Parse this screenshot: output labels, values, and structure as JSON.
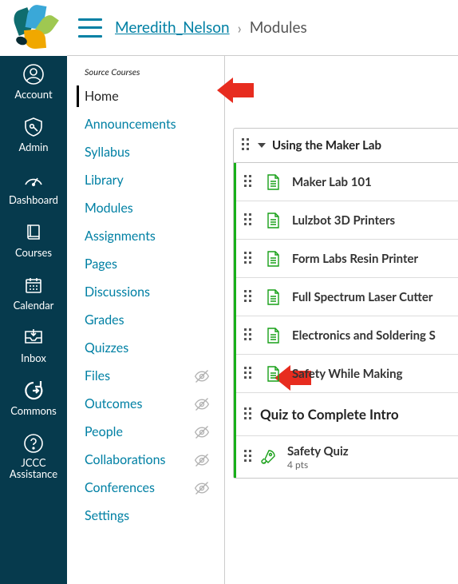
{
  "breadcrumbs": {
    "course": "Meredith_Nelson",
    "current": "Modules"
  },
  "global_nav": [
    {
      "key": "account",
      "label": "Account"
    },
    {
      "key": "admin",
      "label": "Admin"
    },
    {
      "key": "dashboard",
      "label": "Dashboard"
    },
    {
      "key": "courses",
      "label": "Courses"
    },
    {
      "key": "calendar",
      "label": "Calendar"
    },
    {
      "key": "inbox",
      "label": "Inbox"
    },
    {
      "key": "commons",
      "label": "Commons"
    },
    {
      "key": "help",
      "label": "JCCC Assistance"
    }
  ],
  "course_nav": {
    "header": "Source Courses",
    "items": [
      {
        "label": "Home",
        "active": true,
        "hidden": false
      },
      {
        "label": "Announcements",
        "active": false,
        "hidden": false
      },
      {
        "label": "Syllabus",
        "active": false,
        "hidden": false
      },
      {
        "label": "Library",
        "active": false,
        "hidden": false
      },
      {
        "label": "Modules",
        "active": false,
        "hidden": false
      },
      {
        "label": "Assignments",
        "active": false,
        "hidden": false
      },
      {
        "label": "Pages",
        "active": false,
        "hidden": false
      },
      {
        "label": "Discussions",
        "active": false,
        "hidden": false
      },
      {
        "label": "Grades",
        "active": false,
        "hidden": false
      },
      {
        "label": "Quizzes",
        "active": false,
        "hidden": false
      },
      {
        "label": "Files",
        "active": false,
        "hidden": true
      },
      {
        "label": "Outcomes",
        "active": false,
        "hidden": true
      },
      {
        "label": "People",
        "active": false,
        "hidden": true
      },
      {
        "label": "Collaborations",
        "active": false,
        "hidden": true
      },
      {
        "label": "Conferences",
        "active": false,
        "hidden": true
      },
      {
        "label": "Settings",
        "active": false,
        "hidden": false
      }
    ]
  },
  "module": {
    "title": "Using the Maker Lab",
    "items": [
      {
        "type": "page",
        "title": "Maker Lab 101"
      },
      {
        "type": "page",
        "title": "Lulzbot 3D Printers"
      },
      {
        "type": "page",
        "title": "Form Labs Resin Printer"
      },
      {
        "type": "page",
        "title": "Full Spectrum Laser Cutter"
      },
      {
        "type": "page",
        "title": "Electronics and Soldering S"
      },
      {
        "type": "page",
        "title": "Safety While Making"
      }
    ],
    "subheader": "Quiz to Complete Intro",
    "quiz": {
      "title": "Safety Quiz",
      "subtitle": "4 pts"
    }
  }
}
